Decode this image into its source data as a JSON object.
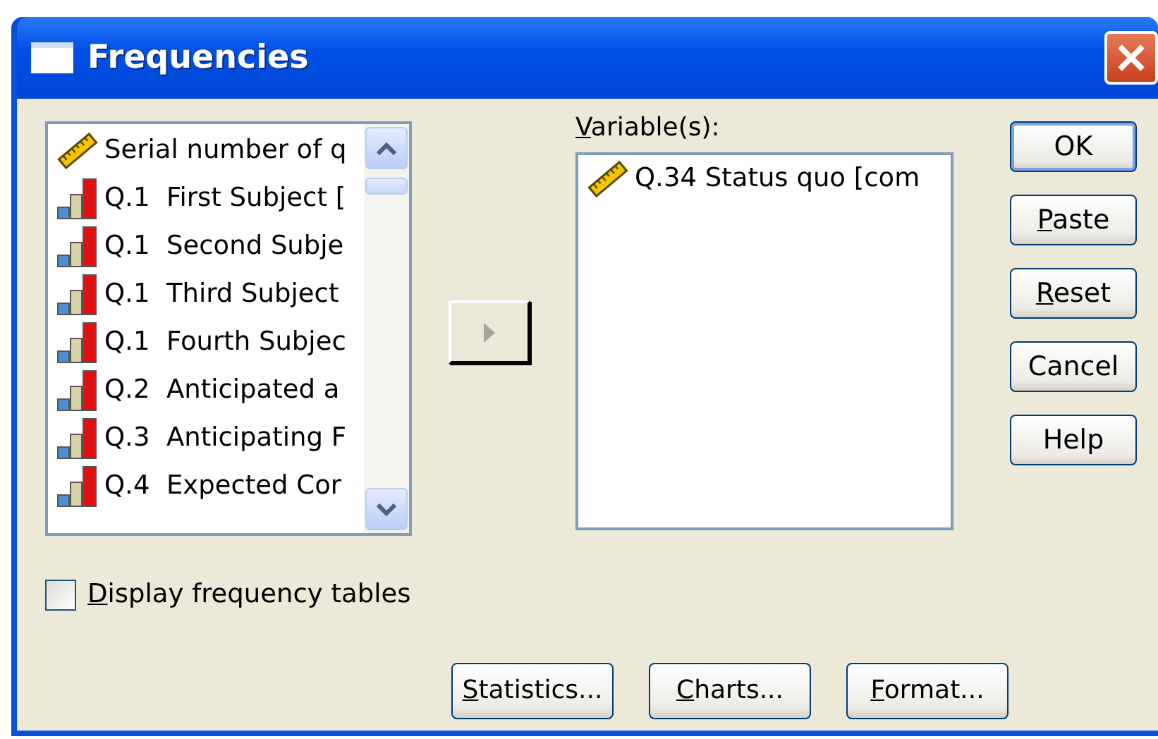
{
  "window": {
    "title": "Frequencies"
  },
  "source_list": {
    "items": [
      {
        "kind": "scale",
        "label": "Serial number of q"
      },
      {
        "kind": "ordinal",
        "label": "Q.1  First Subject ["
      },
      {
        "kind": "ordinal",
        "label": "Q.1  Second Subje"
      },
      {
        "kind": "ordinal",
        "label": "Q.1  Third Subject"
      },
      {
        "kind": "ordinal",
        "label": "Q.1  Fourth Subjec"
      },
      {
        "kind": "ordinal",
        "label": "Q.2  Anticipated a"
      },
      {
        "kind": "ordinal",
        "label": "Q.3  Anticipating F"
      },
      {
        "kind": "ordinal",
        "label": "Q.4  Expected Cor"
      }
    ]
  },
  "move_button": {
    "disabled": true
  },
  "variables": {
    "label": "Variable(s):",
    "mnemonic": true,
    "items": [
      {
        "kind": "scale",
        "label": "Q.34 Status quo [com"
      }
    ]
  },
  "side_buttons": [
    {
      "label": "OK",
      "mnemonic": false,
      "default": true
    },
    {
      "label": "Paste",
      "mnemonic": true,
      "default": false
    },
    {
      "label": "Reset",
      "mnemonic": true,
      "default": false
    },
    {
      "label": "Cancel",
      "mnemonic": false,
      "default": false
    },
    {
      "label": "Help",
      "mnemonic": false,
      "default": false
    }
  ],
  "display_tables": {
    "label": "Display frequency tables",
    "mnemonic": true,
    "checked": false
  },
  "bottom_buttons": [
    {
      "label": "Statistics...",
      "mnemonic": true
    },
    {
      "label": "Charts...",
      "mnemonic": true
    },
    {
      "label": "Format...",
      "mnemonic": true
    }
  ]
}
